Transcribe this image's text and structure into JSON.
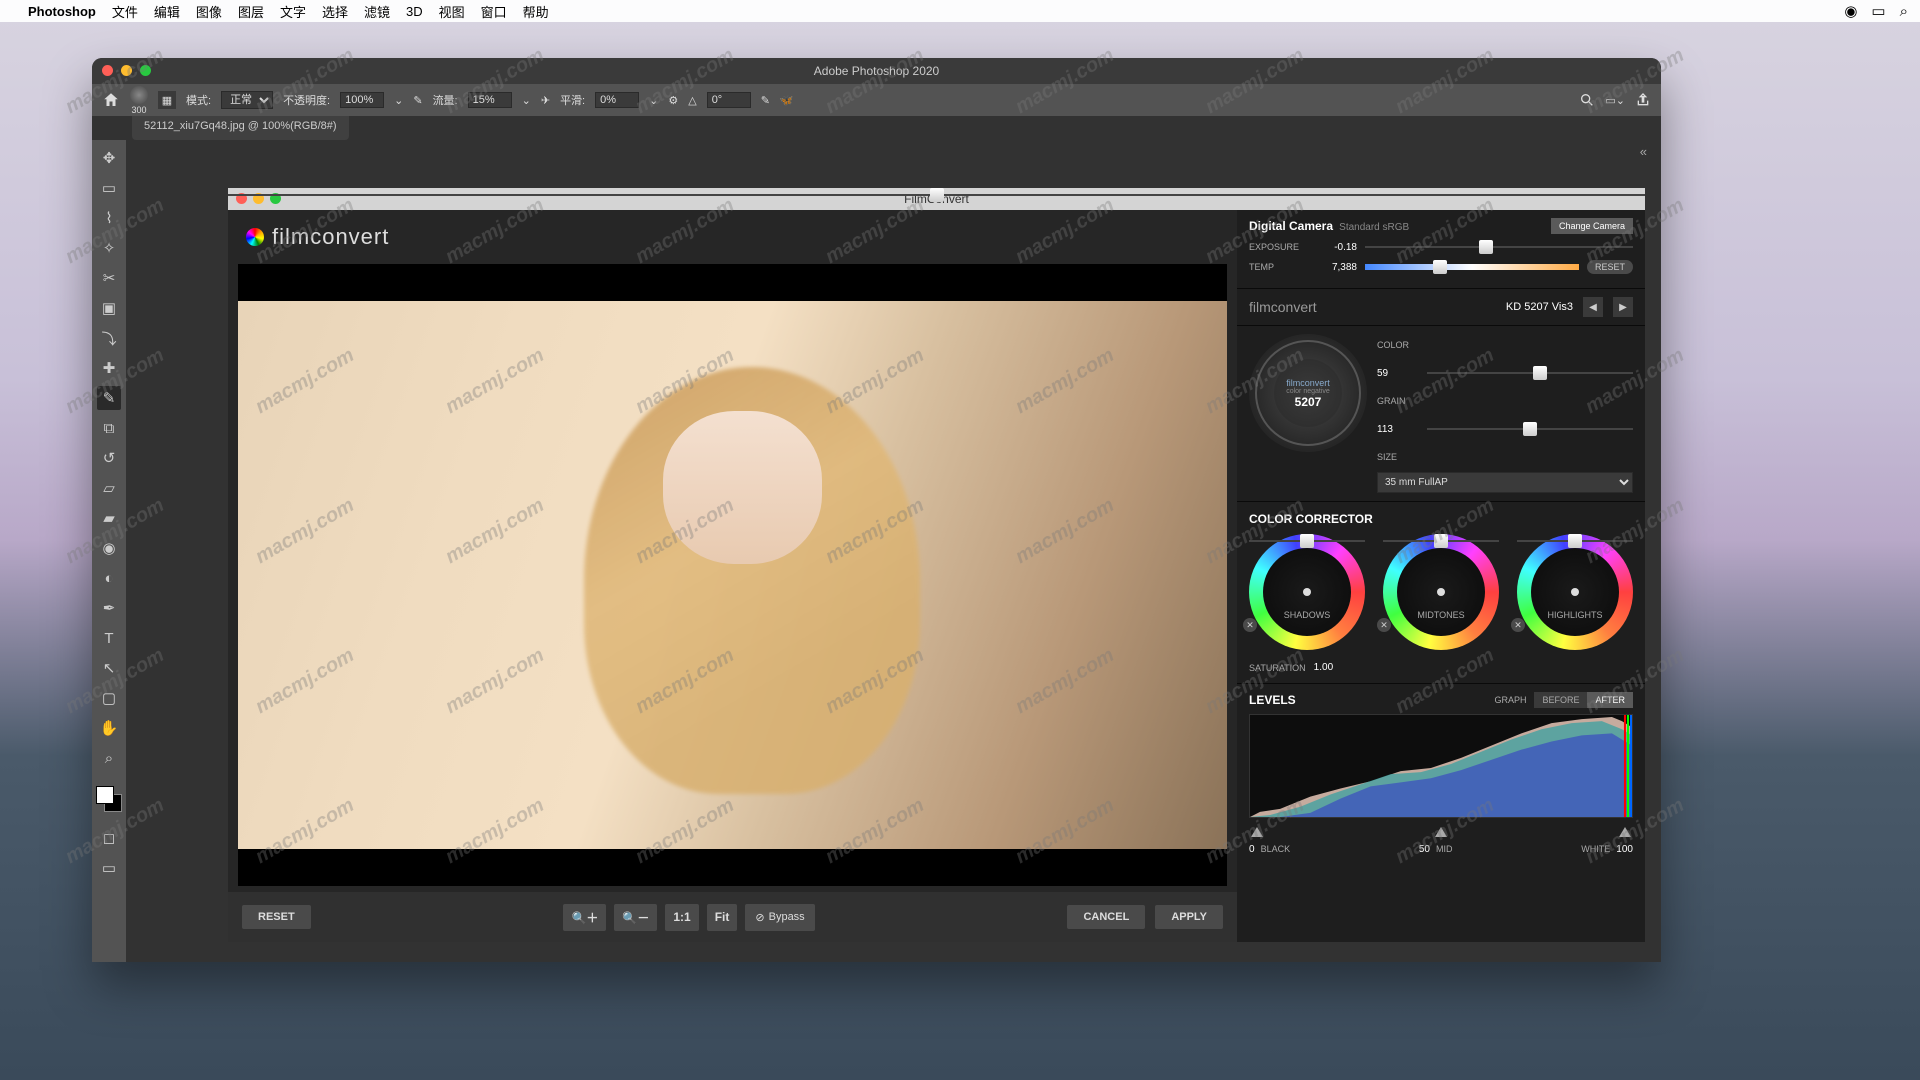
{
  "mac_menu": {
    "app": "Photoshop",
    "items": [
      "文件",
      "编辑",
      "图像",
      "图层",
      "文字",
      "选择",
      "滤镜",
      "3D",
      "视图",
      "窗口",
      "帮助"
    ]
  },
  "ps": {
    "title": "Adobe Photoshop 2020",
    "doc_tab": "52112_xiu7Gq48.jpg @ 100%(RGB/8#)",
    "options": {
      "brush_size": "300",
      "mode_label": "模式:",
      "mode_value": "正常",
      "opacity_label": "不透明度:",
      "opacity_value": "100%",
      "flow_label": "流量:",
      "flow_value": "15%",
      "smooth_label": "平滑:",
      "smooth_value": "0%",
      "angle_label": "△",
      "angle_value": "0°"
    }
  },
  "fc": {
    "title": "FilmConvert",
    "logo": "filmconvert",
    "camera": {
      "name": "Digital Camera",
      "profile": "Standard sRGB",
      "change": "Change Camera"
    },
    "exposure_label": "EXPOSURE",
    "exposure_value": "-0.18",
    "temp_label": "TEMP",
    "temp_value": "7,388",
    "reset": "RESET",
    "stock": "KD 5207 Vis3",
    "dial": {
      "brand": "filmconvert",
      "type": "color negative",
      "num": "5207"
    },
    "color_label": "COLOR",
    "color_value": "59",
    "grain_label": "GRAIN",
    "grain_value": "113",
    "size_label": "SIZE",
    "size_value": "35 mm FullAP",
    "cc_title": "COLOR CORRECTOR",
    "wheels": [
      "SHADOWS",
      "MIDTONES",
      "HIGHLIGHTS"
    ],
    "saturation_label": "SATURATION",
    "saturation_value": "1.00",
    "levels_title": "LEVELS",
    "graph": "GRAPH",
    "before": "BEFORE",
    "after": "AFTER",
    "levels": {
      "black_n": "0",
      "black_t": "BLACK",
      "mid_n": "50",
      "mid_t": "MID",
      "white_t": "WHITE",
      "white_n": "100"
    },
    "bottom": {
      "reset": "RESET",
      "oneToOne": "1:1",
      "fit": "Fit",
      "bypass": "Bypass",
      "cancel": "CANCEL",
      "apply": "APPLY"
    }
  },
  "watermark": "macmj.com"
}
